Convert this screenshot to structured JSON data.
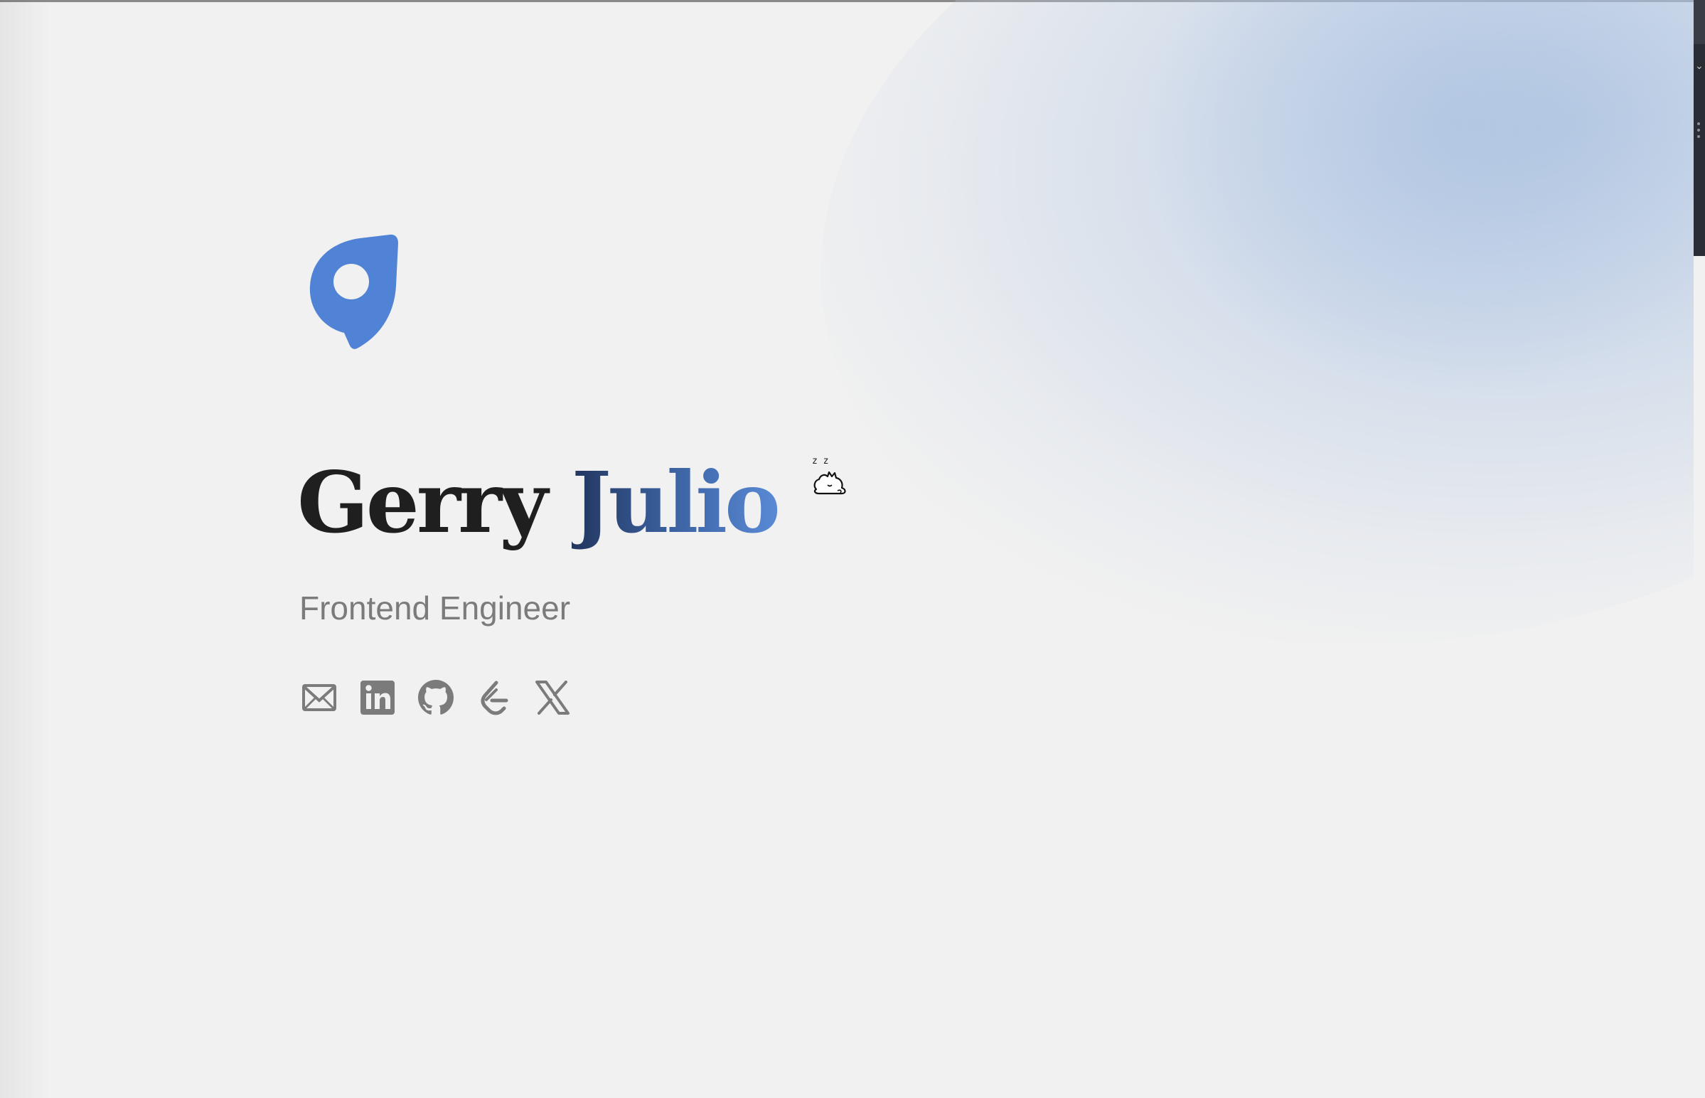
{
  "profile": {
    "first_name": "Gerry",
    "last_name": "Julio",
    "role": "Frontend Engineer"
  },
  "logo": {
    "icon": "location-pin-logo-icon",
    "color": "#5083D6"
  },
  "socials": [
    {
      "icon": "mail-icon",
      "name": "Email"
    },
    {
      "icon": "linkedin-icon",
      "name": "LinkedIn"
    },
    {
      "icon": "github-icon",
      "name": "GitHub"
    },
    {
      "icon": "leetcode-icon",
      "name": "LeetCode"
    },
    {
      "icon": "x-icon",
      "name": "X"
    }
  ],
  "decor": {
    "sleeping_cat": "sleeping-cat-icon",
    "snore_text": "z z"
  },
  "colors": {
    "background": "#F1F1F1",
    "accent": "#5083D6",
    "accent_dark": "#22365F",
    "heading": "#1F1F1F",
    "muted": "#7B7B7B"
  }
}
